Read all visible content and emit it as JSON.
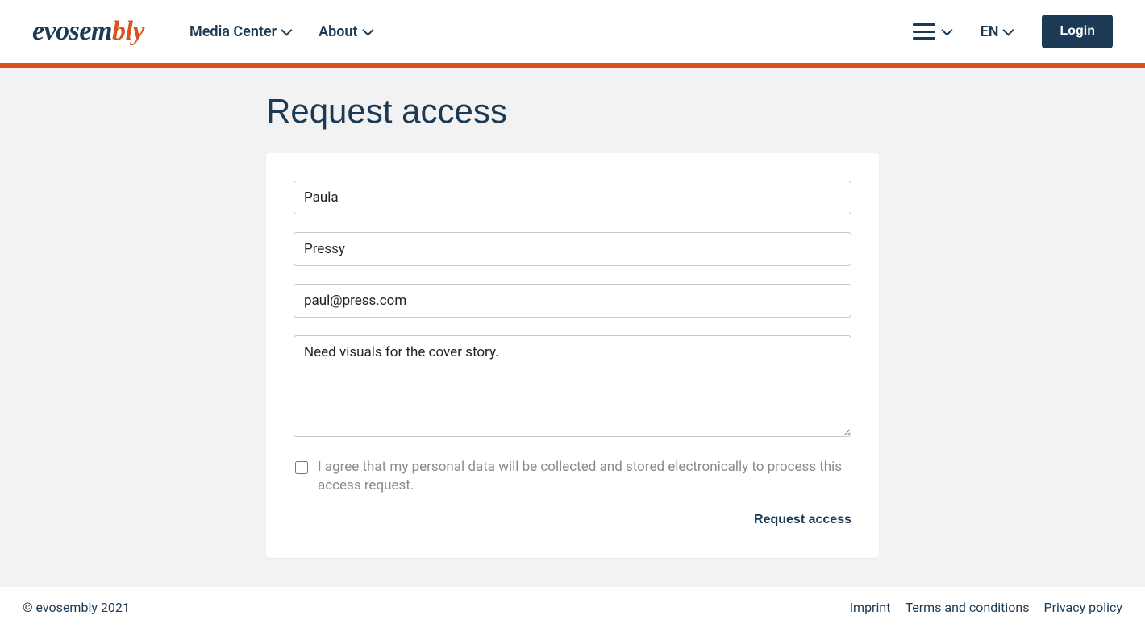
{
  "brand": {
    "part1": "evosem",
    "part2": "bly"
  },
  "nav": {
    "media_center": "Media Center",
    "about": "About",
    "language": "EN",
    "login": "Login"
  },
  "page": {
    "title": "Request access"
  },
  "form": {
    "first_name": "Paula",
    "last_name": "Pressy",
    "email": "paul@press.com",
    "message": "Need visuals for the cover story.",
    "consent_text": "I agree that my personal data will be collected and stored electronically to process this access request.",
    "submit_label": "Request access"
  },
  "footer": {
    "copyright": "© evosembly 2021",
    "imprint": "Imprint",
    "terms": "Terms and conditions",
    "privacy": "Privacy policy"
  }
}
